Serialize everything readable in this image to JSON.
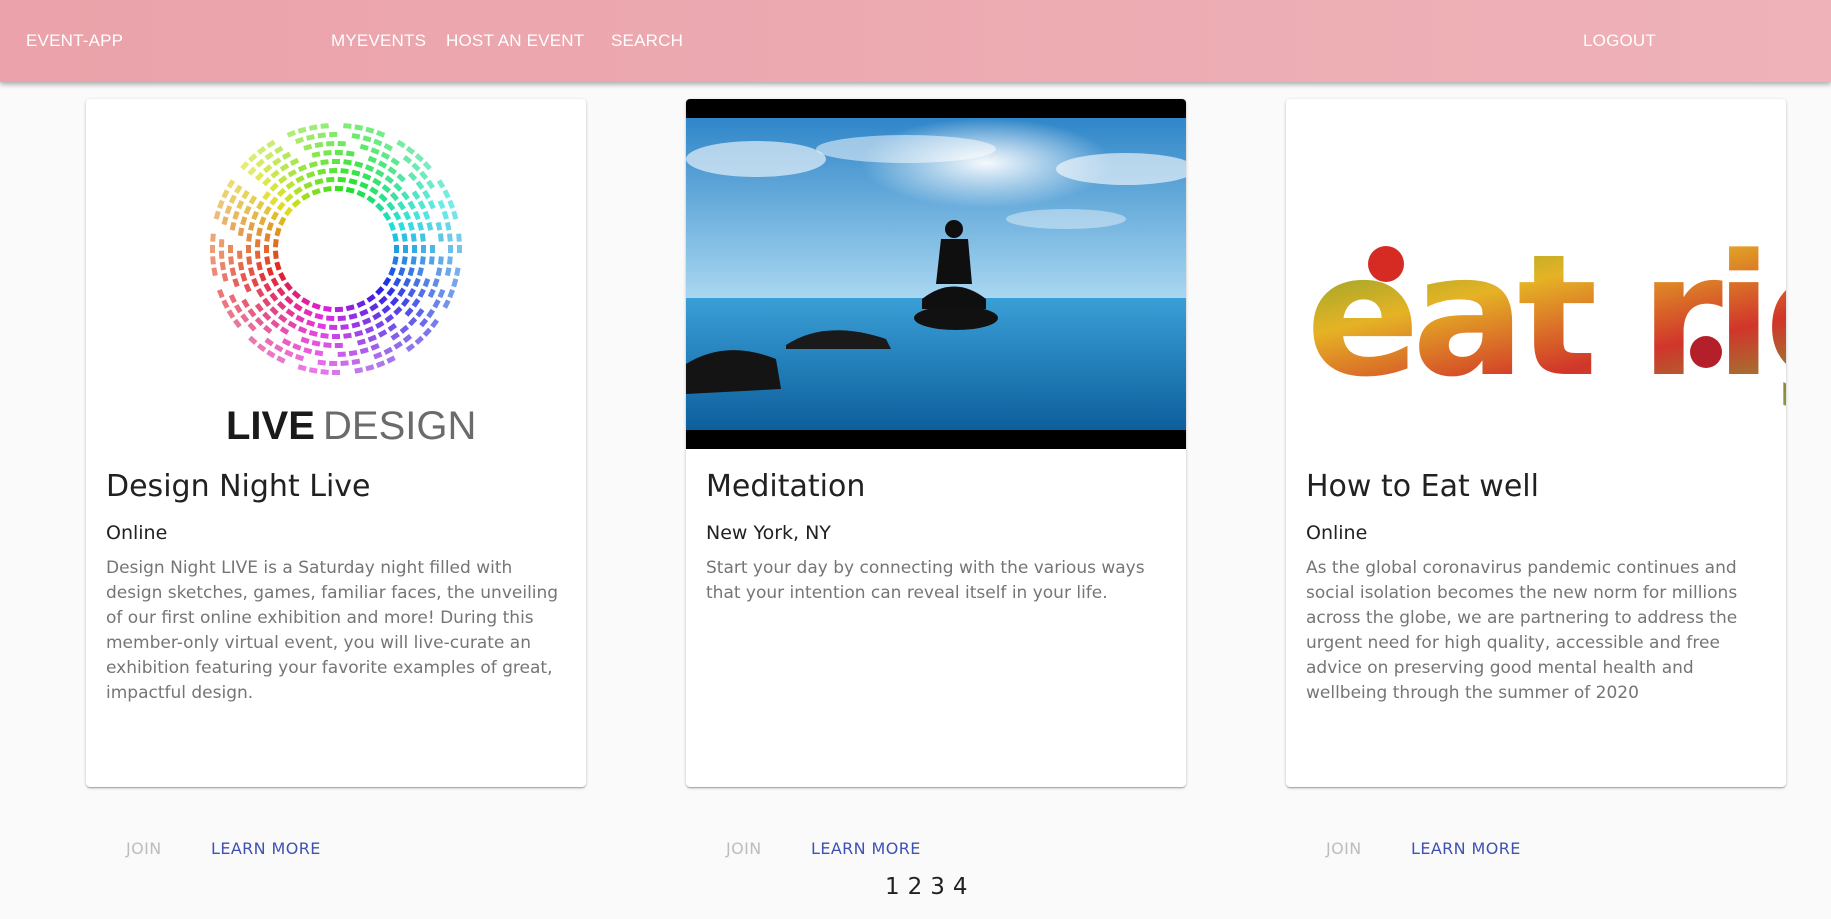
{
  "appbar": {
    "brand": "EVENT-APP",
    "nav": [
      "MYEVENTS",
      "HOST AN EVENT",
      "SEARCH"
    ],
    "logout": "LOGOUT",
    "color": "#eba2aa"
  },
  "cards": [
    {
      "image_text_bold": "LIVE",
      "image_text_light": "DESIGN",
      "title": "Design Night Live",
      "location": "Online",
      "description": "Design Night LIVE is a Saturday night filled with design sketches, games, familiar faces, the unveiling of our first online exhibition and more! During this member-only virtual event, you will live-curate an exhibition featuring your favorite examples of great, impactful design.",
      "join_label": "JOIN",
      "learn_label": "LEARN MORE"
    },
    {
      "title": "Meditation",
      "location": "New York, NY",
      "description": "Start your day by connecting with the various ways that your intention can reveal itself in your life.",
      "join_label": "JOIN",
      "learn_label": "LEARN MORE"
    },
    {
      "image_text": "eat right.",
      "title": "How to Eat well",
      "location": "Online",
      "description": "As the global coronavirus pandemic continues and social isolation becomes the new norm for millions across the globe, we are partnering to address the urgent need for high quality, accessible and free advice on preserving good mental health and wellbeing through the summer of 2020",
      "join_label": "JOIN",
      "learn_label": "LEARN MORE"
    }
  ],
  "pagination": [
    "1",
    "2",
    "3",
    "4"
  ],
  "colors": {
    "primary_button": "#3f51b5",
    "disabled_button": "#bdbdbd"
  }
}
